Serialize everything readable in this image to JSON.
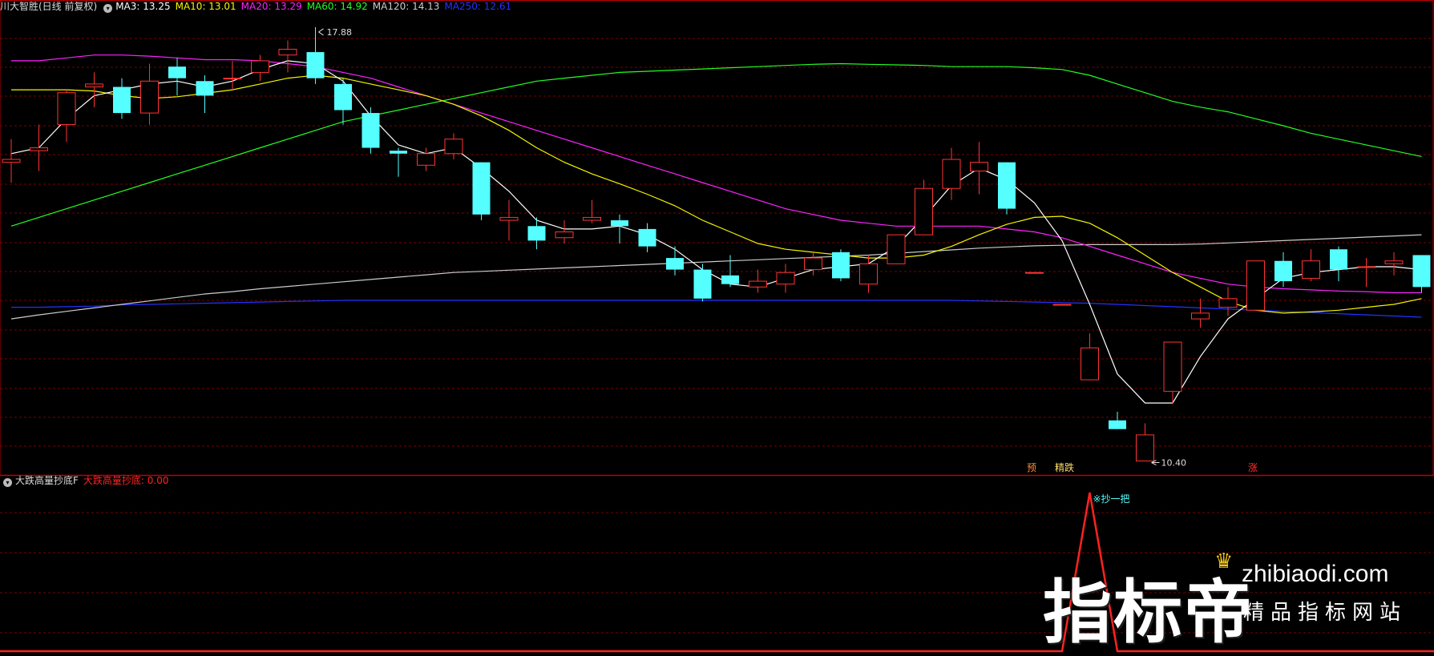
{
  "header": {
    "title": "川大智胜(日线 前复权)",
    "ma": [
      {
        "label": "MA3: 13.25",
        "color": "#ffffff"
      },
      {
        "label": "MA10: 13.01",
        "color": "#f5f500"
      },
      {
        "label": "MA20: 13.29",
        "color": "#ff22ff"
      },
      {
        "label": "MA60: 14.92",
        "color": "#22ff22"
      },
      {
        "label": "MA120: 14.13",
        "color": "#cccccc"
      },
      {
        "label": "MA250: 12.61",
        "color": "#2233ff"
      }
    ]
  },
  "sub_header": {
    "title": "大跌高量抄底F",
    "value": "大跌高量抄底: 0.00",
    "value_color": "#ff2222"
  },
  "annotations": {
    "high_label": "17.88",
    "low_label": "10.40",
    "signal_label": "※抄一把",
    "bottom_labels": [
      "预",
      "精跌",
      "涨"
    ]
  },
  "watermark": {
    "big": "指标帝",
    "url": "zhibiaodi.com",
    "sub": "精品指标网站"
  },
  "colors": {
    "up": "#ff3333",
    "down": "#55ffff",
    "grid": "#7a0000",
    "panel_border": "#c00000"
  },
  "chart_data": {
    "type": "candlestick",
    "candles": [
      [
        15.55,
        15.6,
        15.95,
        15.2
      ],
      [
        15.75,
        15.8,
        16.2,
        15.4
      ],
      [
        16.2,
        16.75,
        16.8,
        15.9
      ],
      [
        16.85,
        16.9,
        17.1,
        16.5
      ],
      [
        16.85,
        16.4,
        17.0,
        16.3
      ],
      [
        16.4,
        16.95,
        17.25,
        16.2
      ],
      [
        17.2,
        17.0,
        17.35,
        16.7
      ],
      [
        16.95,
        16.7,
        17.05,
        16.4
      ],
      [
        17.0,
        17.0,
        17.3,
        16.8
      ],
      [
        17.1,
        17.3,
        17.4,
        16.95
      ],
      [
        17.4,
        17.5,
        17.65,
        17.1
      ],
      [
        17.45,
        17.0,
        17.88,
        16.9
      ],
      [
        16.9,
        16.45,
        17.0,
        16.2
      ],
      [
        16.4,
        15.8,
        16.5,
        15.7
      ],
      [
        15.75,
        15.7,
        15.8,
        15.3
      ],
      [
        15.5,
        15.7,
        15.8,
        15.4
      ],
      [
        15.7,
        15.95,
        16.05,
        15.6
      ],
      [
        15.55,
        14.65,
        15.55,
        14.55
      ],
      [
        14.55,
        14.6,
        14.9,
        14.2
      ],
      [
        14.45,
        14.2,
        14.6,
        14.05
      ],
      [
        14.25,
        14.35,
        14.55,
        14.15
      ],
      [
        14.55,
        14.6,
        14.9,
        14.5
      ],
      [
        14.55,
        14.45,
        14.65,
        14.15
      ],
      [
        14.4,
        14.1,
        14.5,
        14.0
      ],
      [
        13.9,
        13.7,
        14.1,
        13.6
      ],
      [
        13.7,
        13.2,
        13.8,
        13.15
      ],
      [
        13.6,
        13.45,
        13.95,
        13.4
      ],
      [
        13.4,
        13.5,
        13.7,
        13.3
      ],
      [
        13.45,
        13.65,
        13.8,
        13.3
      ],
      [
        13.7,
        13.9,
        14.0,
        13.6
      ],
      [
        14.0,
        13.55,
        14.05,
        13.5
      ],
      [
        13.45,
        13.8,
        13.95,
        13.3
      ],
      [
        13.8,
        14.3,
        14.3,
        13.8
      ],
      [
        14.3,
        15.1,
        15.25,
        14.3
      ],
      [
        15.1,
        15.6,
        15.8,
        14.9
      ],
      [
        15.4,
        15.55,
        15.9,
        15.0
      ],
      [
        15.55,
        14.75,
        15.55,
        14.65
      ],
      [
        13.65,
        13.65,
        13.65,
        13.65
      ],
      [
        13.1,
        13.1,
        13.1,
        13.1
      ],
      [
        11.8,
        12.35,
        12.6,
        11.8
      ],
      [
        11.1,
        10.95,
        11.25,
        10.95
      ],
      [
        10.4,
        10.85,
        11.05,
        10.4
      ],
      [
        11.6,
        12.45,
        12.45,
        11.4
      ],
      [
        12.85,
        12.95,
        13.2,
        12.7
      ],
      [
        13.05,
        13.2,
        13.4,
        12.9
      ],
      [
        13.0,
        13.85,
        13.85,
        13.0
      ],
      [
        13.85,
        13.5,
        14.0,
        13.4
      ],
      [
        13.55,
        13.85,
        14.05,
        13.5
      ],
      [
        14.05,
        13.7,
        14.1,
        13.5
      ],
      [
        13.75,
        13.75,
        13.9,
        13.4
      ],
      [
        13.8,
        13.85,
        14.0,
        13.6
      ],
      [
        13.95,
        13.4,
        13.95,
        13.3
      ]
    ],
    "ma": {
      "MA3": [
        15.7,
        15.8,
        16.3,
        16.7,
        16.8,
        16.9,
        16.95,
        16.85,
        16.95,
        17.15,
        17.3,
        17.25,
        16.95,
        16.35,
        15.85,
        15.7,
        15.8,
        15.45,
        15.05,
        14.55,
        14.4,
        14.4,
        14.45,
        14.3,
        14.05,
        13.7,
        13.45,
        13.4,
        13.55,
        13.7,
        13.75,
        13.8,
        14.1,
        14.6,
        15.15,
        15.45,
        15.25,
        14.85,
        14.2,
        13.1,
        11.9,
        11.4,
        11.4,
        12.2,
        12.85,
        13.2,
        13.55,
        13.65,
        13.7,
        13.75,
        13.75,
        13.7
      ],
      "MA10": [
        16.8,
        16.8,
        16.8,
        16.78,
        16.7,
        16.65,
        16.68,
        16.74,
        16.8,
        16.9,
        17.0,
        17.05,
        17.0,
        16.9,
        16.8,
        16.7,
        16.55,
        16.35,
        16.1,
        15.8,
        15.55,
        15.35,
        15.18,
        15.0,
        14.8,
        14.55,
        14.35,
        14.15,
        14.05,
        14.0,
        13.95,
        13.9,
        13.9,
        13.95,
        14.1,
        14.3,
        14.48,
        14.6,
        14.62,
        14.5,
        14.25,
        13.95,
        13.65,
        13.4,
        13.15,
        13.0,
        12.95,
        12.97,
        13.0,
        13.05,
        13.1,
        13.2
      ],
      "MA20": [
        17.3,
        17.3,
        17.35,
        17.4,
        17.4,
        17.38,
        17.35,
        17.32,
        17.32,
        17.3,
        17.25,
        17.2,
        17.1,
        17.0,
        16.85,
        16.7,
        16.55,
        16.4,
        16.25,
        16.1,
        15.95,
        15.8,
        15.65,
        15.5,
        15.35,
        15.2,
        15.05,
        14.9,
        14.75,
        14.65,
        14.55,
        14.5,
        14.45,
        14.45,
        14.45,
        14.45,
        14.4,
        14.35,
        14.25,
        14.1,
        13.95,
        13.8,
        13.65,
        13.55,
        13.45,
        13.4,
        13.37,
        13.35,
        13.33,
        13.32,
        13.3,
        13.3
      ],
      "MA60": [
        14.45,
        14.6,
        14.75,
        14.9,
        15.05,
        15.2,
        15.35,
        15.5,
        15.65,
        15.8,
        15.95,
        16.1,
        16.25,
        16.35,
        16.45,
        16.55,
        16.65,
        16.75,
        16.85,
        16.95,
        17.0,
        17.05,
        17.1,
        17.12,
        17.14,
        17.16,
        17.18,
        17.2,
        17.22,
        17.24,
        17.25,
        17.24,
        17.23,
        17.22,
        17.2,
        17.2,
        17.2,
        17.18,
        17.15,
        17.05,
        16.9,
        16.75,
        16.6,
        16.5,
        16.42,
        16.3,
        16.18,
        16.05,
        15.95,
        15.85,
        15.75,
        15.65
      ],
      "MA120": [
        12.85,
        12.92,
        12.98,
        13.04,
        13.1,
        13.16,
        13.22,
        13.28,
        13.32,
        13.37,
        13.41,
        13.45,
        13.49,
        13.53,
        13.57,
        13.61,
        13.65,
        13.67,
        13.69,
        13.71,
        13.73,
        13.75,
        13.77,
        13.79,
        13.81,
        13.83,
        13.85,
        13.87,
        13.89,
        13.91,
        13.93,
        13.95,
        13.98,
        14.01,
        14.04,
        14.07,
        14.09,
        14.11,
        14.12,
        14.13,
        14.13,
        14.13,
        14.13,
        14.14,
        14.16,
        14.18,
        14.2,
        14.22,
        14.24,
        14.26,
        14.28,
        14.3
      ],
      "MA250": [
        13.05,
        13.05,
        13.06,
        13.07,
        13.09,
        13.1,
        13.11,
        13.12,
        13.13,
        13.14,
        13.15,
        13.16,
        13.17,
        13.17,
        13.17,
        13.17,
        13.17,
        13.17,
        13.17,
        13.17,
        13.17,
        13.17,
        13.17,
        13.17,
        13.17,
        13.17,
        13.17,
        13.17,
        13.17,
        13.17,
        13.17,
        13.17,
        13.17,
        13.17,
        13.17,
        13.16,
        13.15,
        13.14,
        13.13,
        13.12,
        13.1,
        13.08,
        13.06,
        13.04,
        13.02,
        13.0,
        12.98,
        12.96,
        12.94,
        12.92,
        12.9,
        12.88
      ]
    },
    "ylim": [
      10.2,
      18.1
    ],
    "indicator": {
      "name": "大跌高量抄底",
      "values": [
        0,
        0,
        0,
        0,
        0,
        0,
        0,
        0,
        0,
        0,
        0,
        0,
        0,
        0,
        0,
        0,
        0,
        0,
        0,
        0,
        0,
        0,
        0,
        0,
        0,
        0,
        0,
        0,
        0,
        0,
        0,
        0,
        0,
        0,
        0,
        0,
        0,
        0,
        0,
        1,
        0,
        0,
        0,
        0,
        0,
        0,
        0,
        0,
        0,
        0,
        0,
        0
      ],
      "ylim": [
        0,
        1
      ]
    }
  }
}
